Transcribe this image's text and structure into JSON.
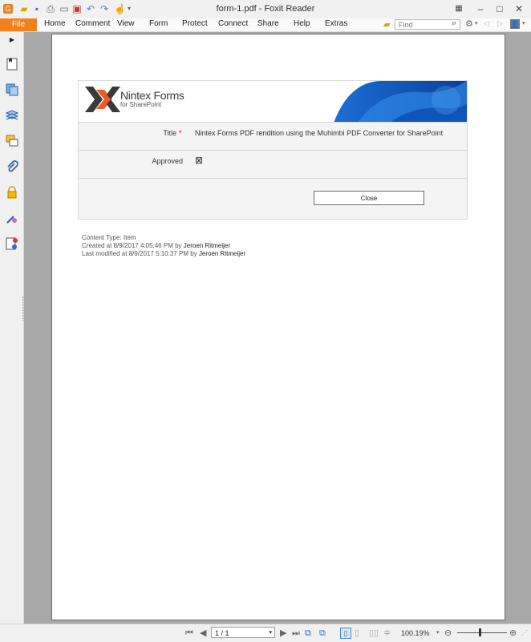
{
  "window": {
    "title": "form-1.pdf - Foxit Reader"
  },
  "menu": {
    "file": "File",
    "items": [
      "Home",
      "Comment",
      "View",
      "Form",
      "Protect",
      "Connect",
      "Share",
      "Help",
      "Extras"
    ]
  },
  "search": {
    "placeholder": "Find"
  },
  "form": {
    "brand": "Nintex Forms",
    "brand_sub": "for SharePoint",
    "title_label": "Title",
    "required_mark": "*",
    "title_value": "Nintex Forms PDF rendition using the Muhimbi PDF Converter for SharePoint",
    "approved_label": "Approved",
    "approved_checkbox": "⊠",
    "close_label": "Close"
  },
  "meta": {
    "content_type": "Content Type: Item",
    "created_prefix": "Created at 8/9/2017 4:05:46 PM by ",
    "created_by": "Jeroen Ritmeijer",
    "modified_prefix": "Last modified at 8/9/2017 5:10:37 PM by ",
    "modified_by": "Jeroen Ritmeijer"
  },
  "status": {
    "page": "1 / 1",
    "zoom": "100.19%"
  },
  "colors": {
    "file_tab": "#f0811e",
    "brand_dark": "#3a3a3a",
    "brand_orange": "#f05a28",
    "banner_blue": "#1a6fd6"
  }
}
